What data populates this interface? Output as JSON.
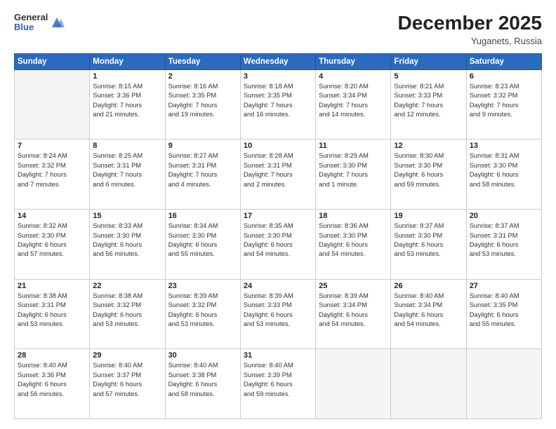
{
  "header": {
    "logo_general": "General",
    "logo_blue": "Blue",
    "title": "December 2025",
    "subtitle": "Yuganets, Russia"
  },
  "columns": [
    "Sunday",
    "Monday",
    "Tuesday",
    "Wednesday",
    "Thursday",
    "Friday",
    "Saturday"
  ],
  "weeks": [
    [
      {
        "day": "",
        "info": ""
      },
      {
        "day": "1",
        "info": "Sunrise: 8:15 AM\nSunset: 3:36 PM\nDaylight: 7 hours\nand 21 minutes."
      },
      {
        "day": "2",
        "info": "Sunrise: 8:16 AM\nSunset: 3:35 PM\nDaylight: 7 hours\nand 19 minutes."
      },
      {
        "day": "3",
        "info": "Sunrise: 8:18 AM\nSunset: 3:35 PM\nDaylight: 7 hours\nand 16 minutes."
      },
      {
        "day": "4",
        "info": "Sunrise: 8:20 AM\nSunset: 3:34 PM\nDaylight: 7 hours\nand 14 minutes."
      },
      {
        "day": "5",
        "info": "Sunrise: 8:21 AM\nSunset: 3:33 PM\nDaylight: 7 hours\nand 12 minutes."
      },
      {
        "day": "6",
        "info": "Sunrise: 8:23 AM\nSunset: 3:32 PM\nDaylight: 7 hours\nand 9 minutes."
      }
    ],
    [
      {
        "day": "7",
        "info": "Sunrise: 8:24 AM\nSunset: 3:32 PM\nDaylight: 7 hours\nand 7 minutes."
      },
      {
        "day": "8",
        "info": "Sunrise: 8:25 AM\nSunset: 3:31 PM\nDaylight: 7 hours\nand 6 minutes."
      },
      {
        "day": "9",
        "info": "Sunrise: 8:27 AM\nSunset: 3:31 PM\nDaylight: 7 hours\nand 4 minutes."
      },
      {
        "day": "10",
        "info": "Sunrise: 8:28 AM\nSunset: 3:31 PM\nDaylight: 7 hours\nand 2 minutes."
      },
      {
        "day": "11",
        "info": "Sunrise: 8:29 AM\nSunset: 3:30 PM\nDaylight: 7 hours\nand 1 minute."
      },
      {
        "day": "12",
        "info": "Sunrise: 8:30 AM\nSunset: 3:30 PM\nDaylight: 6 hours\nand 59 minutes."
      },
      {
        "day": "13",
        "info": "Sunrise: 8:31 AM\nSunset: 3:30 PM\nDaylight: 6 hours\nand 58 minutes."
      }
    ],
    [
      {
        "day": "14",
        "info": "Sunrise: 8:32 AM\nSunset: 3:30 PM\nDaylight: 6 hours\nand 57 minutes."
      },
      {
        "day": "15",
        "info": "Sunrise: 8:33 AM\nSunset: 3:30 PM\nDaylight: 6 hours\nand 56 minutes."
      },
      {
        "day": "16",
        "info": "Sunrise: 8:34 AM\nSunset: 3:30 PM\nDaylight: 6 hours\nand 55 minutes."
      },
      {
        "day": "17",
        "info": "Sunrise: 8:35 AM\nSunset: 3:30 PM\nDaylight: 6 hours\nand 54 minutes."
      },
      {
        "day": "18",
        "info": "Sunrise: 8:36 AM\nSunset: 3:30 PM\nDaylight: 6 hours\nand 54 minutes."
      },
      {
        "day": "19",
        "info": "Sunrise: 8:37 AM\nSunset: 3:30 PM\nDaylight: 6 hours\nand 53 minutes."
      },
      {
        "day": "20",
        "info": "Sunrise: 8:37 AM\nSunset: 3:31 PM\nDaylight: 6 hours\nand 53 minutes."
      }
    ],
    [
      {
        "day": "21",
        "info": "Sunrise: 8:38 AM\nSunset: 3:31 PM\nDaylight: 6 hours\nand 53 minutes."
      },
      {
        "day": "22",
        "info": "Sunrise: 8:38 AM\nSunset: 3:32 PM\nDaylight: 6 hours\nand 53 minutes."
      },
      {
        "day": "23",
        "info": "Sunrise: 8:39 AM\nSunset: 3:32 PM\nDaylight: 6 hours\nand 53 minutes."
      },
      {
        "day": "24",
        "info": "Sunrise: 8:39 AM\nSunset: 3:33 PM\nDaylight: 6 hours\nand 53 minutes."
      },
      {
        "day": "25",
        "info": "Sunrise: 8:39 AM\nSunset: 3:34 PM\nDaylight: 6 hours\nand 54 minutes."
      },
      {
        "day": "26",
        "info": "Sunrise: 8:40 AM\nSunset: 3:34 PM\nDaylight: 6 hours\nand 54 minutes."
      },
      {
        "day": "27",
        "info": "Sunrise: 8:40 AM\nSunset: 3:35 PM\nDaylight: 6 hours\nand 55 minutes."
      }
    ],
    [
      {
        "day": "28",
        "info": "Sunrise: 8:40 AM\nSunset: 3:36 PM\nDaylight: 6 hours\nand 56 minutes."
      },
      {
        "day": "29",
        "info": "Sunrise: 8:40 AM\nSunset: 3:37 PM\nDaylight: 6 hours\nand 57 minutes."
      },
      {
        "day": "30",
        "info": "Sunrise: 8:40 AM\nSunset: 3:38 PM\nDaylight: 6 hours\nand 58 minutes."
      },
      {
        "day": "31",
        "info": "Sunrise: 8:40 AM\nSunset: 3:39 PM\nDaylight: 6 hours\nand 59 minutes."
      },
      {
        "day": "",
        "info": ""
      },
      {
        "day": "",
        "info": ""
      },
      {
        "day": "",
        "info": ""
      }
    ]
  ]
}
